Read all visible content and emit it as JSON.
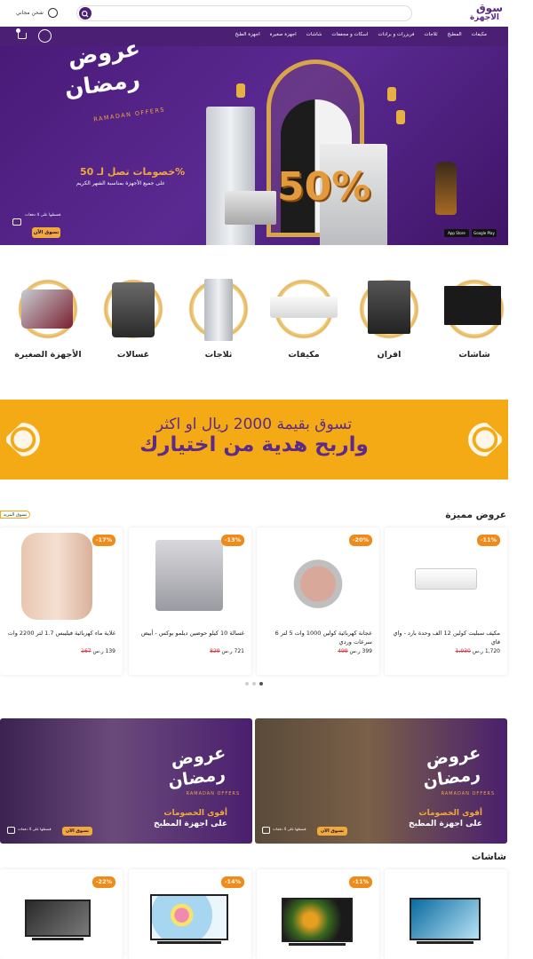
{
  "header": {
    "logo_line1": "سوق",
    "logo_line2": "الاجهزة",
    "search_placeholder": "",
    "shipping_label": "شحن مجاني"
  },
  "nav": {
    "items": [
      "مكيفات",
      "المطبخ",
      "ثلاجات",
      "فريزرات و برادات",
      "اسكات و مجففات",
      "شاشات",
      "اجهزة صغيرة",
      "اجهزة الطبخ"
    ]
  },
  "hero": {
    "title_line1": "عروض",
    "title_line2": "رمضان",
    "subtitle_en": "RAMADAN OFFERS",
    "discount_text": "خصومات تصل لـ 50%",
    "discount_sub": "على جميع الأجهزة بمناسبة الشهر الكريم",
    "big_number": "50%",
    "shop_button": "تسوق الآن",
    "installment_text": "قسطها على 4 دفعات",
    "app_store": "App Store",
    "google_play": "Google Play"
  },
  "categories": [
    {
      "label": "شاشات",
      "icon": "tv-icon"
    },
    {
      "label": "افران",
      "icon": "oven-icon"
    },
    {
      "label": "مكيفات",
      "icon": "ac-icon"
    },
    {
      "label": "ثلاجات",
      "icon": "fridge-icon"
    },
    {
      "label": "غسالات",
      "icon": "washer-icon"
    },
    {
      "label": "الأجهزة الصغيرة",
      "icon": "small-appliances-icon"
    }
  ],
  "promo": {
    "line1": "تسوق بقيمة 2000 ريال او اكثر",
    "line2": "واربح هدية من اختيارك"
  },
  "featured": {
    "title": "عروض مميزة",
    "more": "تسوق المزيد",
    "products": [
      {
        "discount": "-11%",
        "name": "مكيف سبليت كولين 12 الف وحدة بارد - واي فاي",
        "old_price": "1,930",
        "price": "1,720 ر.س"
      },
      {
        "discount": "-20%",
        "name": "عجانة كهربائية كولين 1000 وات 5 لتر 6 سرعات وردي",
        "old_price": "499",
        "price": "399 ر.س"
      },
      {
        "discount": "-13%",
        "name": "غسالة 10 كيلو حوضين ديلمو بوكس - أبيض",
        "old_price": "829",
        "price": "721 ر.س"
      },
      {
        "discount": "-17%",
        "name": "غلاية ماء كهربائية فيليبس 1.7 لتر 2200 وات",
        "old_price": "167",
        "price": "139 ر.س"
      }
    ],
    "dots": 3,
    "active_dot": 0
  },
  "banners": [
    {
      "title1": "عروض",
      "title2": "رمضان",
      "sub_en": "RAMADAN OFFERS",
      "line1": "أقوى الخصومات",
      "line2": "على اجهزة المطبخ",
      "button": "تسوق الآن",
      "installment": "قسطها على 4 دفعات"
    },
    {
      "title1": "عروض",
      "title2": "رمضان",
      "sub_en": "RAMADAN OFFERS",
      "line1": "أقوى الخصومات",
      "line2": "على اجهزة المطبخ",
      "button": "تسوق الآن",
      "installment": "قسطها على 4 دفعات"
    }
  ],
  "screens": {
    "title": "شاشات",
    "products": [
      {
        "discount": ""
      },
      {
        "discount": "-11%"
      },
      {
        "discount": "-14%"
      },
      {
        "discount": "-22%"
      }
    ]
  },
  "colors": {
    "brand_purple": "#4b1f73",
    "accent_orange": "#f08a18",
    "promo_yellow": "#f4aa14",
    "gold": "#e6b042"
  }
}
